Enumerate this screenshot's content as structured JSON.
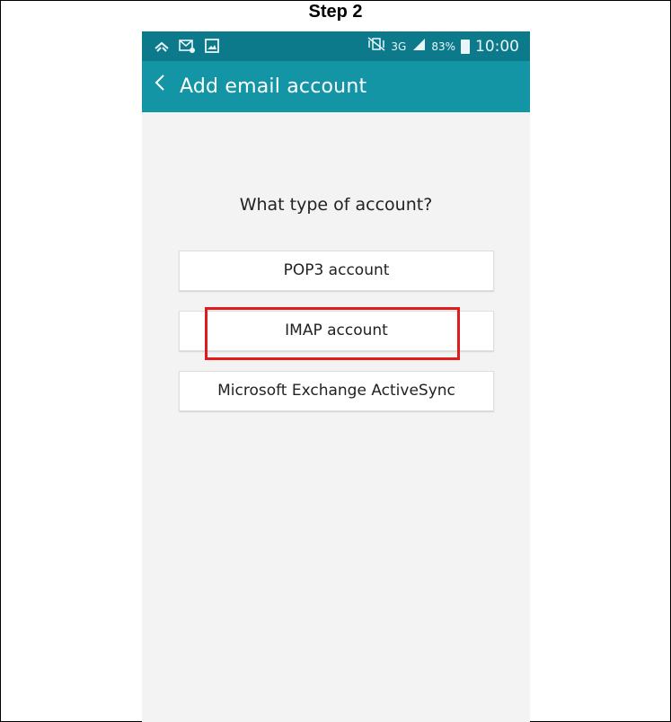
{
  "header": {
    "step_title": "Step 2"
  },
  "statusbar": {
    "left_icons": [
      "missed-call-icon",
      "email-notification-icon",
      "gallery-icon"
    ],
    "mute_icon": "vibrate-mute-icon",
    "network": "3G",
    "signal_icon": "signal-icon",
    "battery_percent": "83%",
    "time": "10:00"
  },
  "appbar": {
    "back_icon": "chevron-left-icon",
    "title": "Add email account"
  },
  "main": {
    "question": "What type of account?",
    "options": [
      {
        "label": "POP3 account"
      },
      {
        "label": "IMAP account"
      },
      {
        "label": "Microsoft Exchange ActiveSync"
      }
    ],
    "highlighted_option": "IMAP account"
  },
  "colors": {
    "statusbar_bg": "#0d7a8b",
    "appbar_bg": "#1395a6",
    "screen_bg": "#f3f3f3",
    "highlight": "#e01b1b"
  }
}
